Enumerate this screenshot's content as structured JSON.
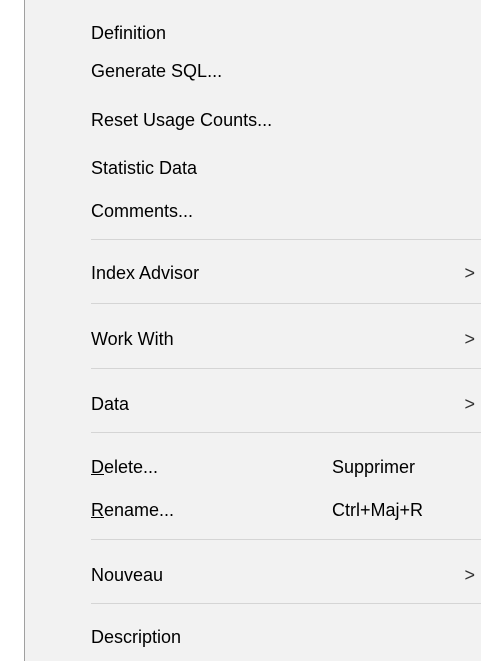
{
  "menu": {
    "definition": "Definition",
    "generate_sql": "Generate SQL...",
    "reset_usage_counts": "Reset Usage Counts...",
    "statistic_data": "Statistic Data",
    "comments": "Comments...",
    "index_advisor": "Index Advisor",
    "work_with": "Work With",
    "data": "Data",
    "delete_mnemonic": "D",
    "delete_rest": "elete...",
    "delete_shortcut": "Supprimer",
    "rename_mnemonic": "R",
    "rename_rest": "ename...",
    "rename_shortcut": "Ctrl+Maj+R",
    "nouveau": "Nouveau",
    "description": "Description",
    "submenu_arrow": ">"
  }
}
